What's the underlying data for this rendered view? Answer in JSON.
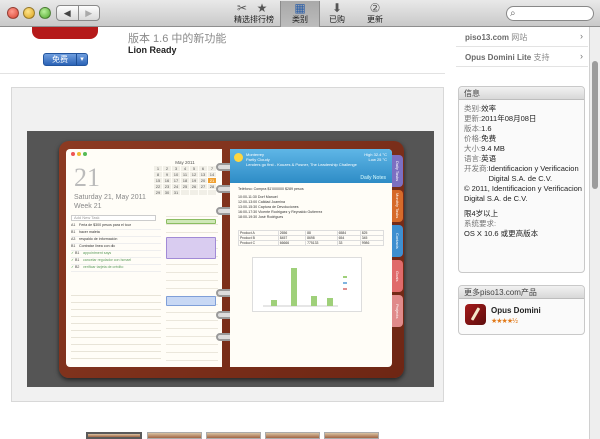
{
  "toolbar": {
    "back_icon": "◀",
    "forward_icon": "▶",
    "tabs": [
      {
        "label": "精选",
        "icon": "✂"
      },
      {
        "label": "排行榜",
        "icon": "★"
      },
      {
        "label": "类别",
        "icon": "▦"
      },
      {
        "label": "已购",
        "icon": "⬇"
      },
      {
        "label": "更新",
        "icon": "②"
      }
    ],
    "active_tab": "类别",
    "search_placeholder": ""
  },
  "app": {
    "version_line": "版本 1.6 中的新功能",
    "requirement": "Lion Ready",
    "buy_label": "免费",
    "buy_dropdown": "▾"
  },
  "screenshot": {
    "calendar_day": "21",
    "date_text": "Saturday 21, May 2011",
    "week_text": "Week 21",
    "month_label": "May 2011",
    "add_task_placeholder": "Add New Task",
    "tasks": [
      {
        "priority": "A1",
        "text": "Feria de $300 pesos para el tour",
        "done": false
      },
      {
        "priority": "B1",
        "text": "hacer maleta",
        "done": false
      },
      {
        "priority": "A3",
        "text": "respaldo de información",
        "done": false
      },
      {
        "priority": "B1",
        "text": "Contratar línea con dlc",
        "done": false
      },
      {
        "priority": "B1",
        "text": "appointment says",
        "done": true
      },
      {
        "priority": "B1",
        "text": "cancelar regulador con Ismael",
        "done": true
      },
      {
        "priority": "B2",
        "text": "verificar tarjeta de crédito",
        "done": true
      }
    ],
    "weather": {
      "city": "Monterrey",
      "condition": "Partly Cloudy",
      "low": "Low 25 °C",
      "high": "High 32.4 °C",
      "quote": "Lenders go first - Kouzes & Posner, The Leadership Challenge",
      "label": "Daily Notes"
    },
    "tabs": [
      "Daily Tasks",
      "Monthly Tasks",
      "Contacts",
      "Goals",
      "Projects"
    ],
    "notes": [
      "Teléfono: Compra $1'000000 $289 pesos",
      "10:00-11:30 Dorf Manuel",
      "12:00-13:00 Calidad Joamina",
      "13:00-15:30 Captura de Devoluciones",
      "16:00-17:30 Vicente Rodriguez y Reynaldo Gutierrez",
      "18:00-19:30 José Rodrigues"
    ],
    "table_rows": [
      [
        "Product A",
        "2656",
        "88",
        "6584",
        "825"
      ],
      [
        "Product B",
        "8457",
        "8698",
        "654",
        "345"
      ],
      [
        "Product C",
        "66666",
        "775133",
        "33",
        "9986"
      ]
    ]
  },
  "sidebar": {
    "links": [
      {
        "site": "piso13.com",
        "suffix": "网站"
      },
      {
        "site": "Opus Domini Lite",
        "suffix": "支持"
      }
    ],
    "arrow": "›",
    "info_title": "信息",
    "info": [
      {
        "key": "类别:",
        "value": "效率"
      },
      {
        "key": "更新:",
        "value": "2011年08月08日"
      },
      {
        "key": "版本:",
        "value": "1.6"
      },
      {
        "key": "价格:",
        "value": "免费"
      },
      {
        "key": "大小:",
        "value": "9.4 MB"
      },
      {
        "key": "语言:",
        "value": "英语"
      },
      {
        "key": "开发商:",
        "value": "Identificacion y Verificacion Digital S.A. de C.V."
      },
      {
        "key": "",
        "value": "© 2011, Identificacion y Verificacion Digital S.A. de C.V."
      }
    ],
    "rating": "限4岁以上",
    "sysreq_label": "系统要求:",
    "sysreq_value": "OS X 10.6 或更高版本",
    "more_title": "更多piso13.com产品",
    "related_app": {
      "name": "Opus Domini",
      "stars": "★★★★½",
      "rating": 4.5
    }
  }
}
